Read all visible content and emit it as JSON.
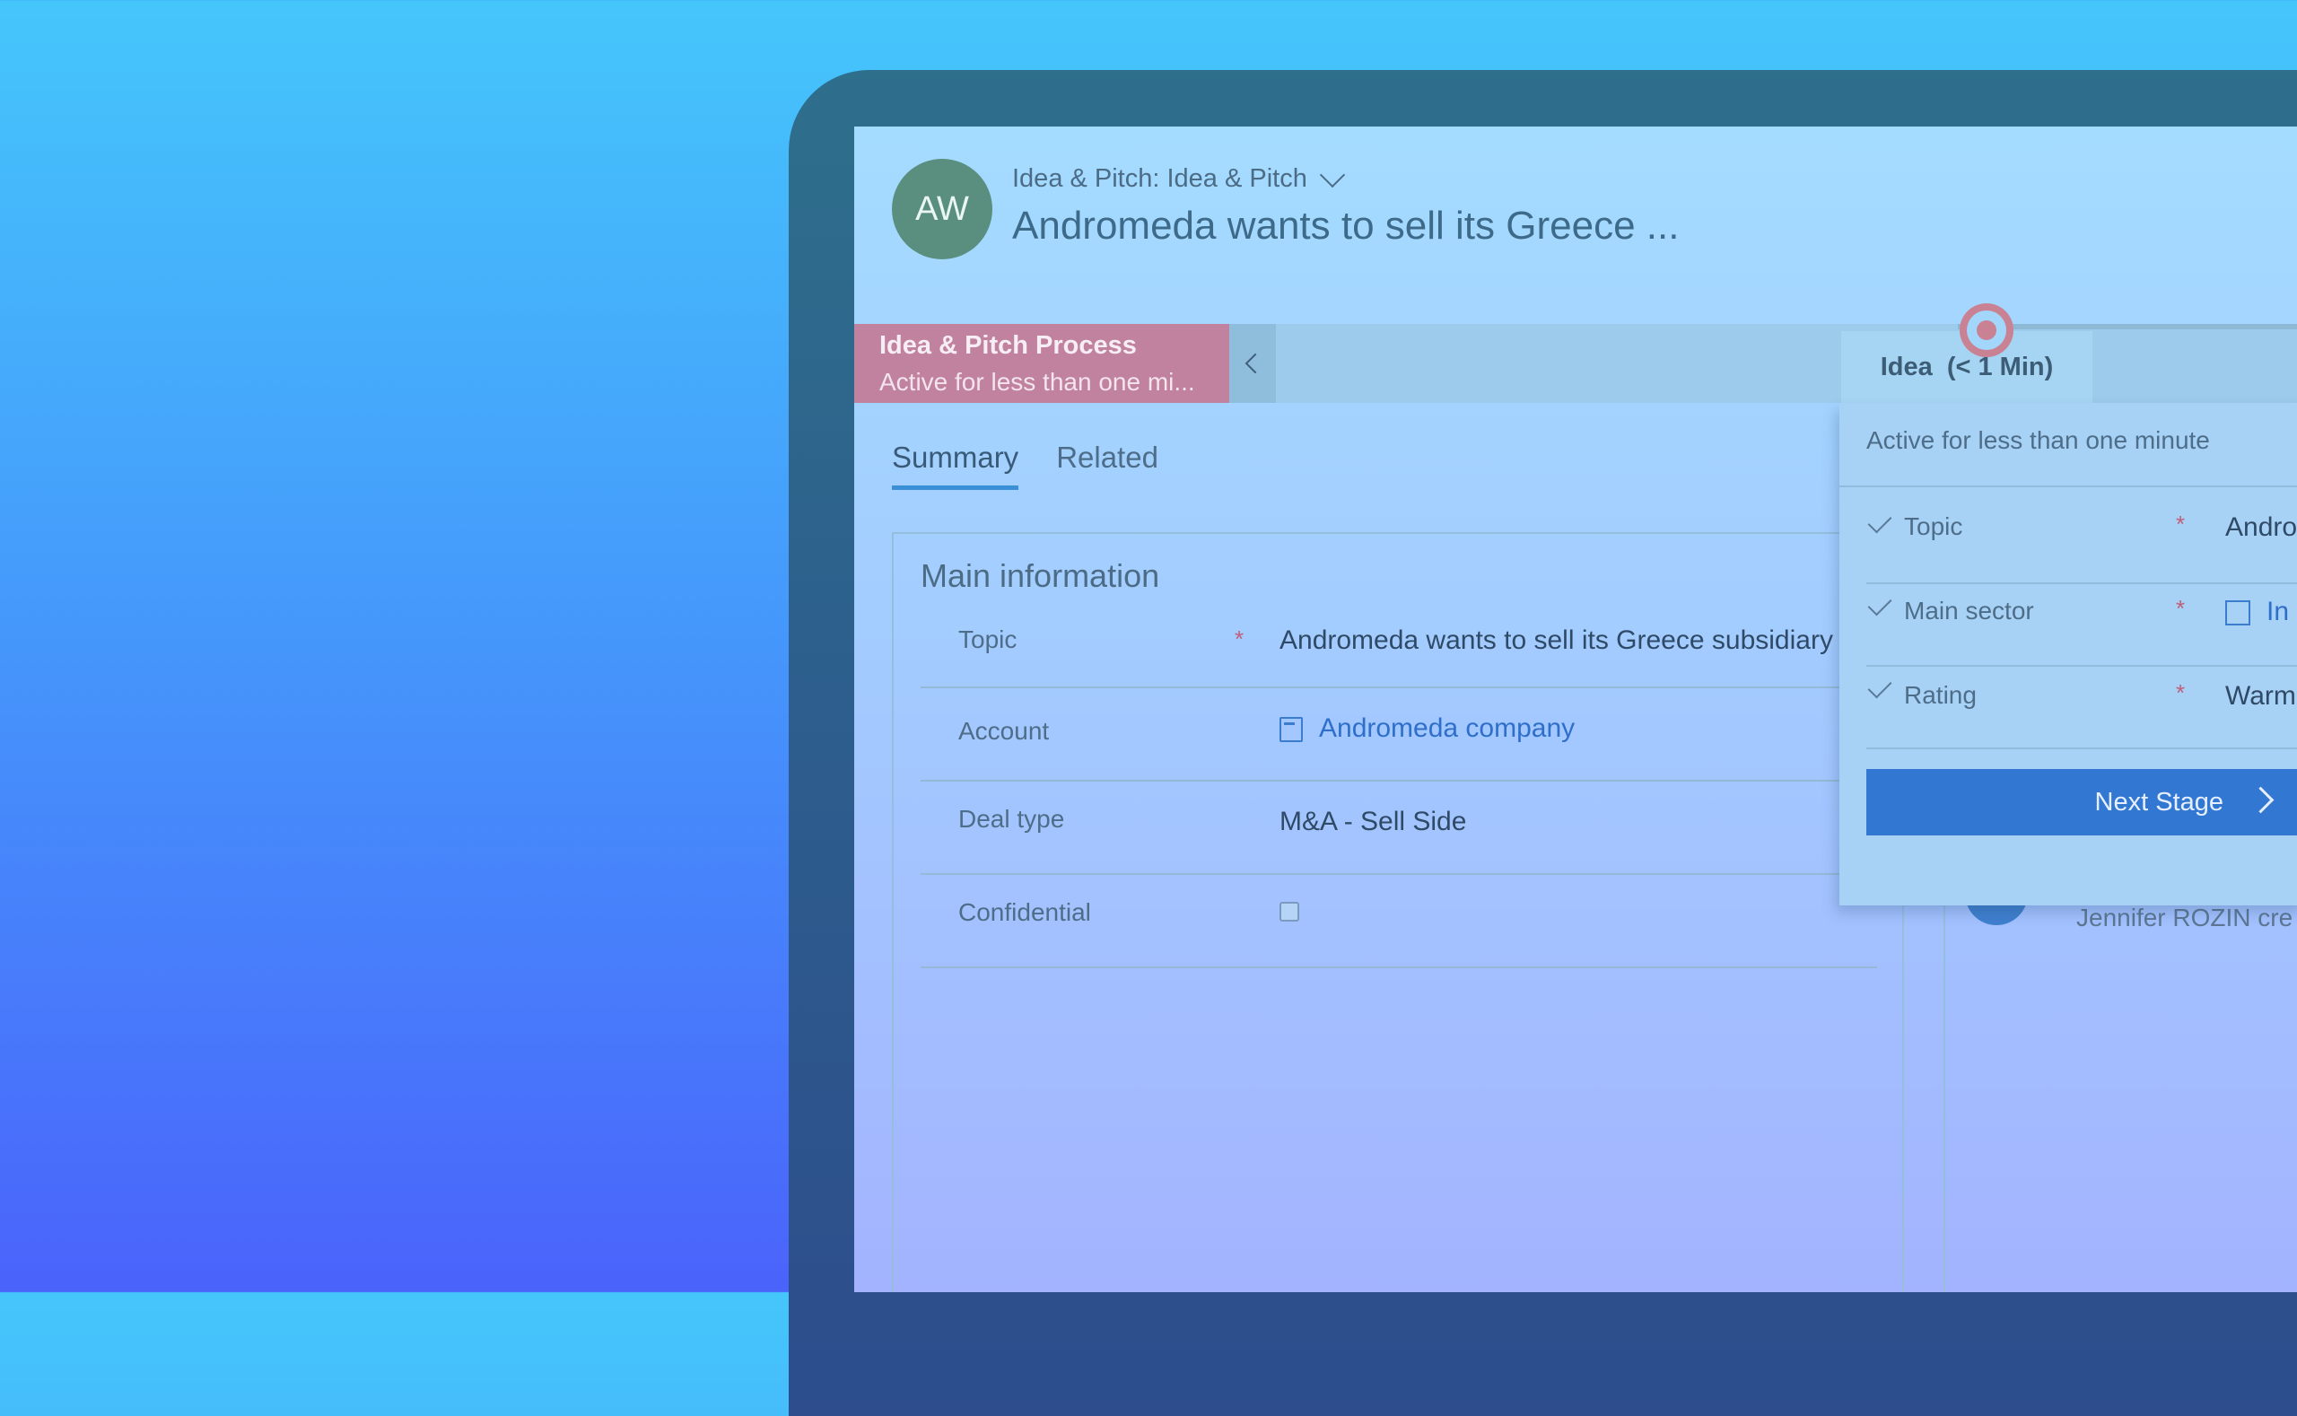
{
  "header": {
    "avatar_initials": "AW",
    "breadcrumb": "Idea & Pitch: Idea & Pitch",
    "title": "Andromeda wants to sell its Greece ..."
  },
  "process": {
    "name": "Idea & Pitch Process",
    "status": "Active for less than one mi...",
    "stage_label": "Idea  (< 1 Min)"
  },
  "tabs": [
    "Summary",
    "Related"
  ],
  "main_info": {
    "title": "Main information",
    "fields": [
      {
        "label": "Topic",
        "required": "*",
        "value": "Andromeda wants to sell its Greece subsidiary"
      },
      {
        "label": "Account",
        "required": "",
        "value": "Andromeda company"
      },
      {
        "label": "Deal type",
        "required": "",
        "value": "M&A - Sell Side"
      },
      {
        "label": "Confidential",
        "required": "",
        "value": ""
      }
    ]
  },
  "flyout": {
    "status": "Active for less than one minute",
    "fields": [
      {
        "label": "Topic",
        "required": "*",
        "value": "Andro"
      },
      {
        "label": "Main sector",
        "required": "*",
        "value": "In"
      },
      {
        "label": "Rating",
        "required": "*",
        "value": "Warm"
      }
    ],
    "next_stage": "Next Stage"
  },
  "timeline": {
    "text": "Jennifer ROZIN cre"
  },
  "colors": {
    "accent": "#3277d2",
    "process_active": "#c0829e",
    "link": "#2f6fc9"
  }
}
